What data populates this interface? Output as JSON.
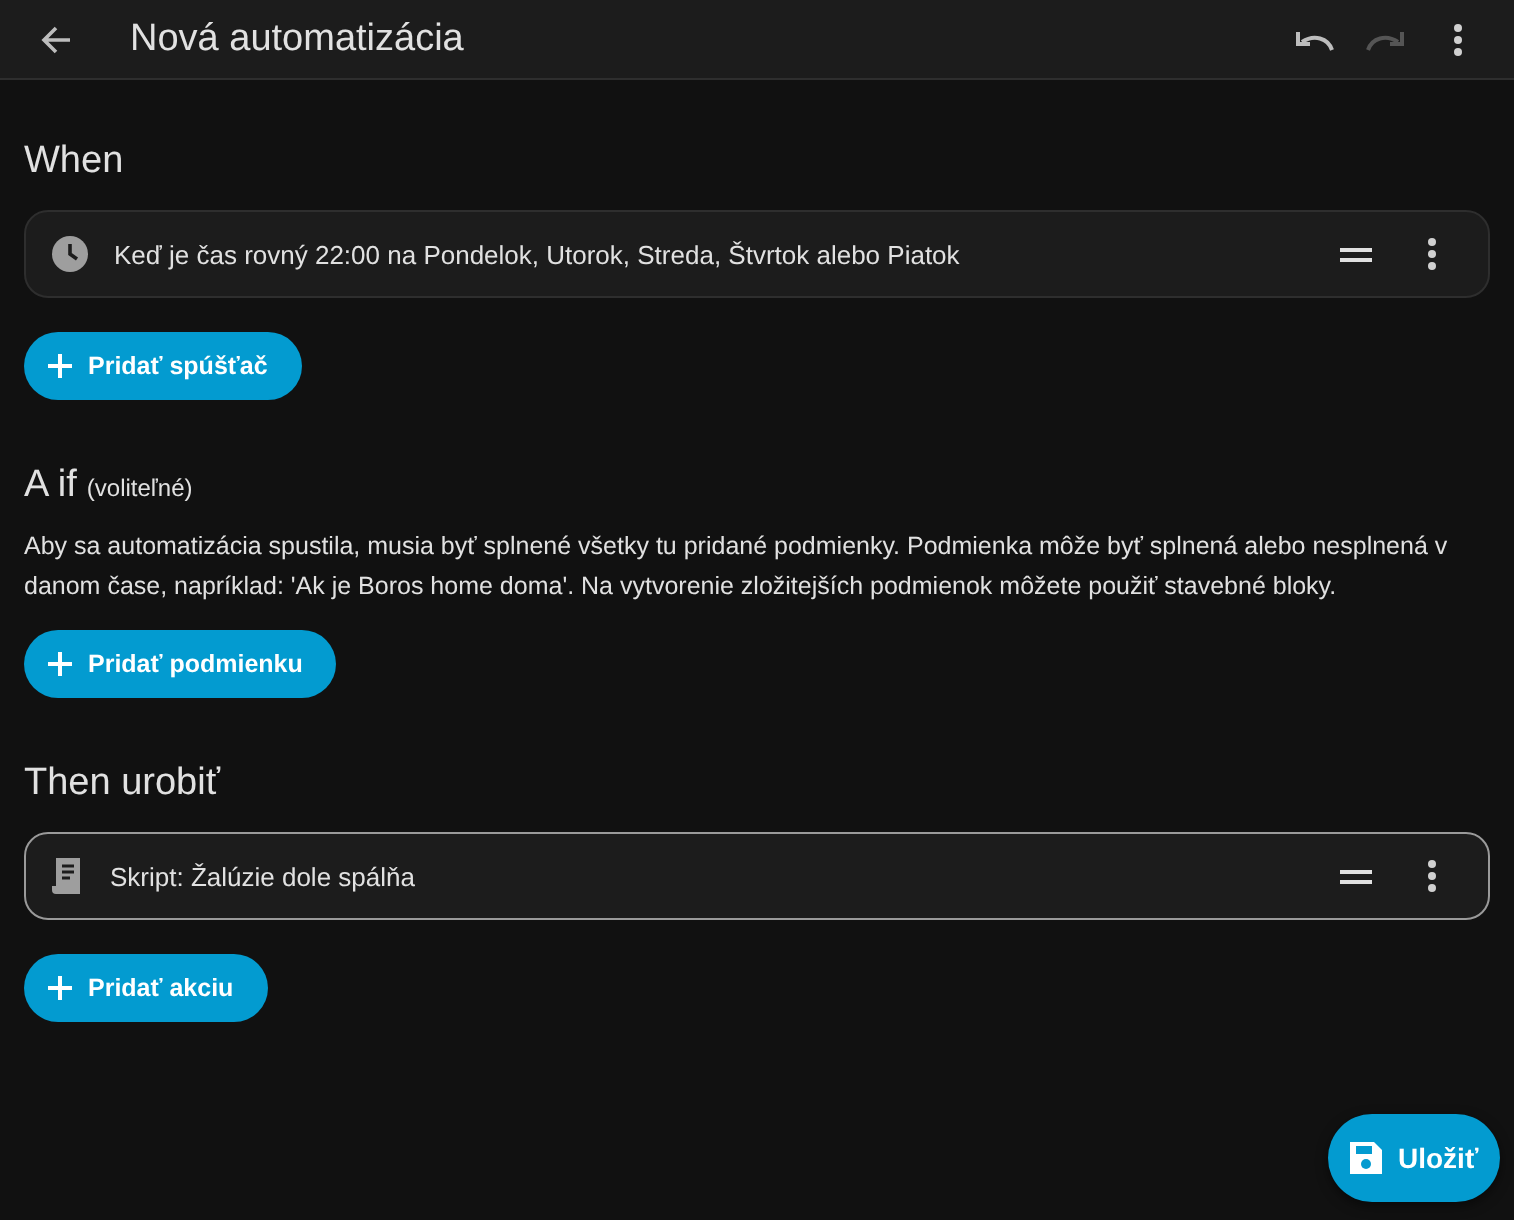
{
  "header": {
    "title": "Nová automatizácia",
    "undo_disabled": false,
    "redo_disabled": true
  },
  "sections": [
    {
      "heading": "When",
      "cards": [
        {
          "kind": "clock",
          "text": "Keď je čas rovný 22:00 na Pondelok, Utorok, Streda, Štvrtok alebo Piatok",
          "selected": false
        }
      ],
      "button": "Pridať spúšťač"
    },
    {
      "heading": "A if",
      "note": "(voliteľné)",
      "description": "Aby sa automatizácia spustila, musia byť splnené všetky tu pridané podmienky. Podmienka môže byť splnená alebo nesplnená v danom čase, napríklad: 'Ak je Boros home doma'. Na vytvorenie zložitejších podmienok môžete použiť stavebné bloky.",
      "button": "Pridať podmienku"
    },
    {
      "heading": "Then urobiť",
      "cards": [
        {
          "kind": "script",
          "text": "Skript: Žalúzie dole spálňa",
          "selected": true
        }
      ],
      "button": "Pridať akciu"
    }
  ],
  "save_button": "Uložiť"
}
